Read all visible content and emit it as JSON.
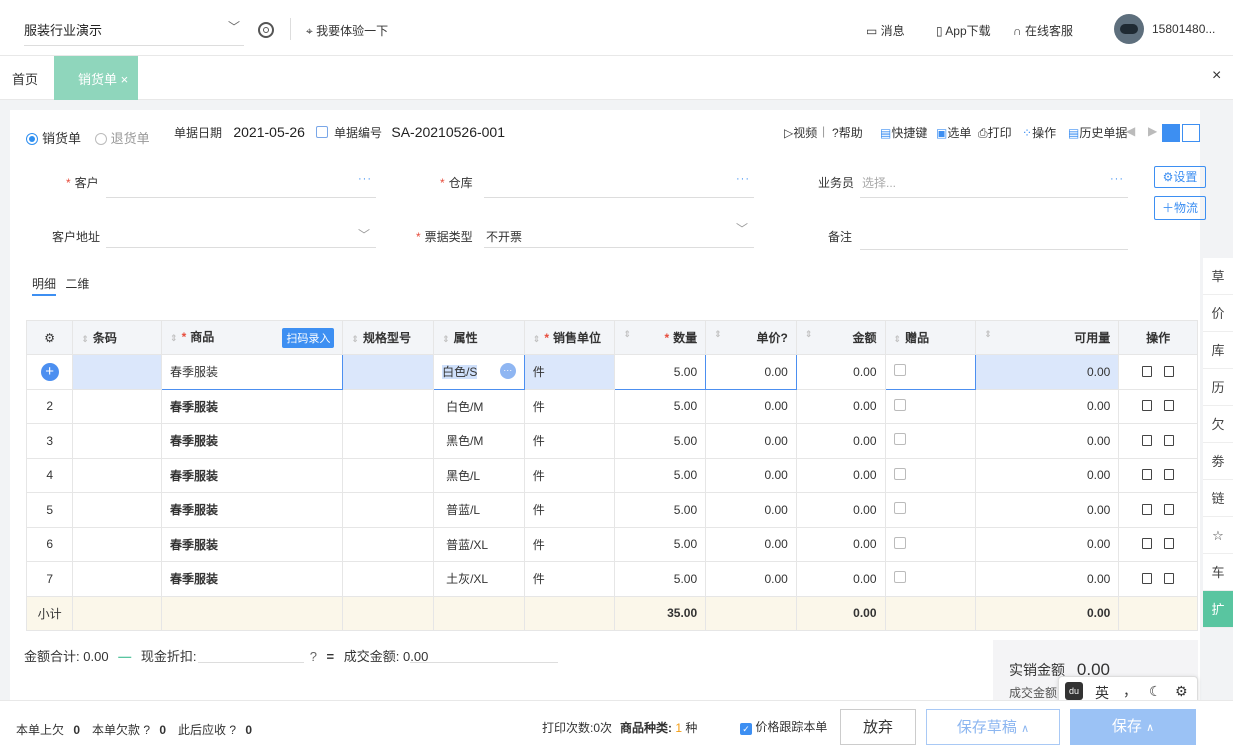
{
  "topbar": {
    "company": "服装行业演示",
    "try_label": "我要体验一下",
    "messages": "消息",
    "app_download": "App下载",
    "support": "在线客服",
    "user": "15801480..."
  },
  "tabs": {
    "home": "首页",
    "active": "销货单",
    "close_all": "×"
  },
  "doc": {
    "type_sale": "销货单",
    "type_return": "退货单",
    "date_label": "单据日期",
    "date_value": "2021-05-26",
    "number_label": "单据编号",
    "number_value": "SA-20210526-001"
  },
  "toolbar": {
    "video": "视频",
    "help": "帮助",
    "shortcut": "快捷键",
    "select": "选单",
    "print": "打印",
    "operate": "操作",
    "history": "历史单据"
  },
  "form": {
    "customer_label": "客户",
    "warehouse_label": "仓库",
    "salesman_label": "业务员",
    "salesman_placeholder": "选择...",
    "settings_button": "设置",
    "logistics_button": "物流",
    "address_label": "客户地址",
    "invoice_type_label": "票据类型",
    "invoice_type_value": "不开票",
    "remark_label": "备注"
  },
  "subtabs": {
    "detail": "明细",
    "matrix": "二维"
  },
  "table": {
    "headers": {
      "barcode": "条码",
      "product": "商品",
      "scan": "扫码录入",
      "spec": "规格型号",
      "attr": "属性",
      "unit": "销售单位",
      "qty": "数量",
      "price": "单价",
      "amount": "金额",
      "gift": "赠品",
      "available": "可用量",
      "ops": "操作"
    },
    "rows": [
      {
        "idx": "",
        "product": "春季服装",
        "attr": "白色/S",
        "unit": "件",
        "qty": "5.00",
        "price": "0.00",
        "amount": "0.00",
        "available": "0.00"
      },
      {
        "idx": "2",
        "product": "春季服装",
        "attr": "白色/M",
        "unit": "件",
        "qty": "5.00",
        "price": "0.00",
        "amount": "0.00",
        "available": "0.00"
      },
      {
        "idx": "3",
        "product": "春季服装",
        "attr": "黑色/M",
        "unit": "件",
        "qty": "5.00",
        "price": "0.00",
        "amount": "0.00",
        "available": "0.00"
      },
      {
        "idx": "4",
        "product": "春季服装",
        "attr": "黑色/L",
        "unit": "件",
        "qty": "5.00",
        "price": "0.00",
        "amount": "0.00",
        "available": "0.00"
      },
      {
        "idx": "5",
        "product": "春季服装",
        "attr": "普蓝/L",
        "unit": "件",
        "qty": "5.00",
        "price": "0.00",
        "amount": "0.00",
        "available": "0.00"
      },
      {
        "idx": "6",
        "product": "春季服装",
        "attr": "普蓝/XL",
        "unit": "件",
        "qty": "5.00",
        "price": "0.00",
        "amount": "0.00",
        "available": "0.00"
      },
      {
        "idx": "7",
        "product": "春季服装",
        "attr": "土灰/XL",
        "unit": "件",
        "qty": "5.00",
        "price": "0.00",
        "amount": "0.00",
        "available": "0.00"
      }
    ],
    "subtotal": {
      "label": "小计",
      "qty": "35.00",
      "amount": "0.00",
      "available": "0.00"
    }
  },
  "totals": {
    "amount_label": "金额合计:",
    "amount_value": "0.00",
    "discount_label": "现金折扣:",
    "deal_label": "成交金额:",
    "deal_value": "0.00",
    "actual_label": "实销金额",
    "actual_value": "0.00",
    "deal_label_2": "成交金额"
  },
  "ime": {
    "lang": "英",
    "punct": "，"
  },
  "footer": {
    "prev_debt_label": "本单上欠",
    "prev_debt_value": "0",
    "this_debt_label": "本单欠款",
    "this_debt_value": "0",
    "after_recv_label": "此后应收",
    "after_recv_value": "0",
    "print_count": "打印次数:0次",
    "product_kinds_label": "商品种类:",
    "product_kinds_value": "1",
    "product_kinds_unit": "种",
    "price_track": "价格跟踪本单",
    "give_up": "放弃",
    "save_draft": "保存草稿",
    "save": "保存"
  },
  "rail": {
    "items": [
      "草",
      "价",
      "库",
      "历",
      "欠",
      "劵",
      "链",
      "☆",
      "车",
      "扩"
    ]
  },
  "colors": {
    "accent_blue": "#3d8ff2",
    "tab_green": "#8fd6bc",
    "required_red": "#e74c3c"
  }
}
